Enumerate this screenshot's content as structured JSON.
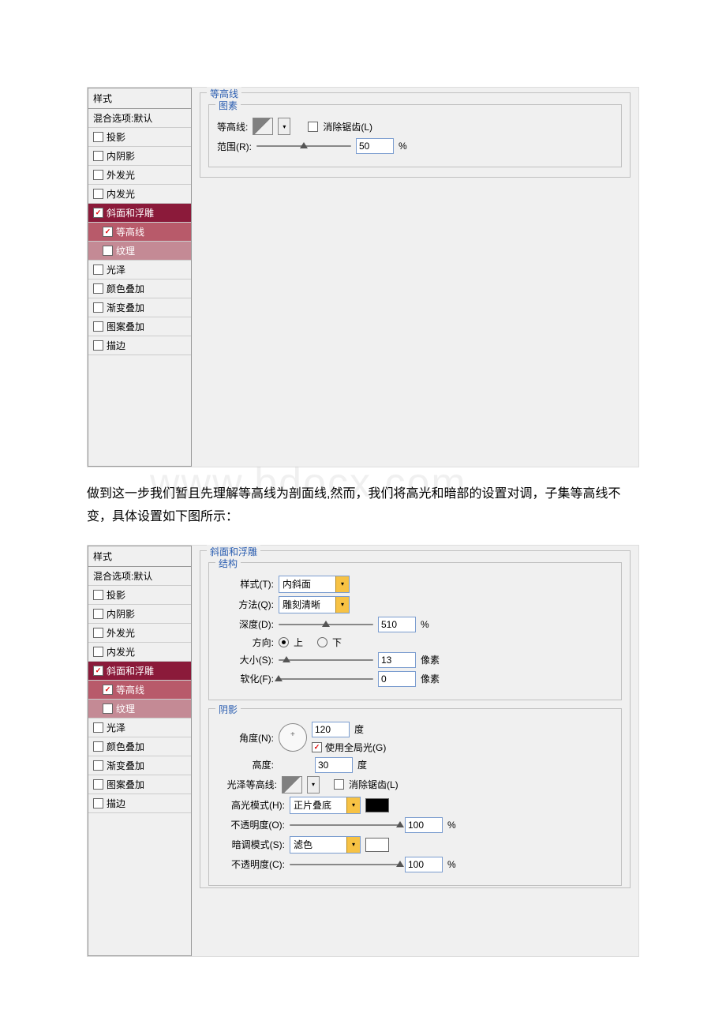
{
  "styles_header": "样式",
  "blend_options": "混合选项:默认",
  "style_items": {
    "drop_shadow": "投影",
    "inner_shadow": "内阴影",
    "outer_glow": "外发光",
    "inner_glow": "内发光",
    "bevel_emboss": "斜面和浮雕",
    "contour": "等高线",
    "texture": "纹理",
    "satin": "光泽",
    "color_overlay": "颜色叠加",
    "gradient_overlay": "渐变叠加",
    "pattern_overlay": "图案叠加",
    "stroke": "描边"
  },
  "panel1": {
    "title": "等高线",
    "inner_title": "图素",
    "contour_label": "等高线:",
    "antialias": "消除锯齿(L)",
    "range_label": "范围(R):",
    "range_value": "50",
    "range_unit": "%"
  },
  "watermark": "www.bdocx.com",
  "body_text": "做到这一步我们暂且先理解等高线为剖面线,然而，我们将高光和暗部的设置对调，子集等高线不变，具体设置如下图所示：",
  "panel2": {
    "title": "斜面和浮雕",
    "struct_title": "结构",
    "style_label": "样式(T):",
    "style_value": "内斜面",
    "method_label": "方法(Q):",
    "method_value": "雕刻清晰",
    "depth_label": "深度(D):",
    "depth_value": "510",
    "depth_unit": "%",
    "direction_label": "方向:",
    "dir_up": "上",
    "dir_down": "下",
    "size_label": "大小(S):",
    "size_value": "13",
    "size_unit": "像素",
    "soften_label": "软化(F):",
    "soften_value": "0",
    "soften_unit": "像素",
    "shade_title": "阴影",
    "angle_label": "角度(N):",
    "angle_value": "120",
    "angle_unit": "度",
    "global_light": "使用全局光(G)",
    "altitude_label": "高度:",
    "altitude_value": "30",
    "altitude_unit": "度",
    "gloss_label": "光泽等高线:",
    "antialias": "消除锯齿(L)",
    "highlight_mode_label": "高光模式(H):",
    "highlight_mode_value": "正片叠底",
    "hi_opacity_label": "不透明度(O):",
    "hi_opacity_value": "100",
    "hi_opacity_unit": "%",
    "shadow_mode_label": "暗调模式(S):",
    "shadow_mode_value": "滤色",
    "sh_opacity_label": "不透明度(C):",
    "sh_opacity_value": "100",
    "sh_opacity_unit": "%"
  }
}
